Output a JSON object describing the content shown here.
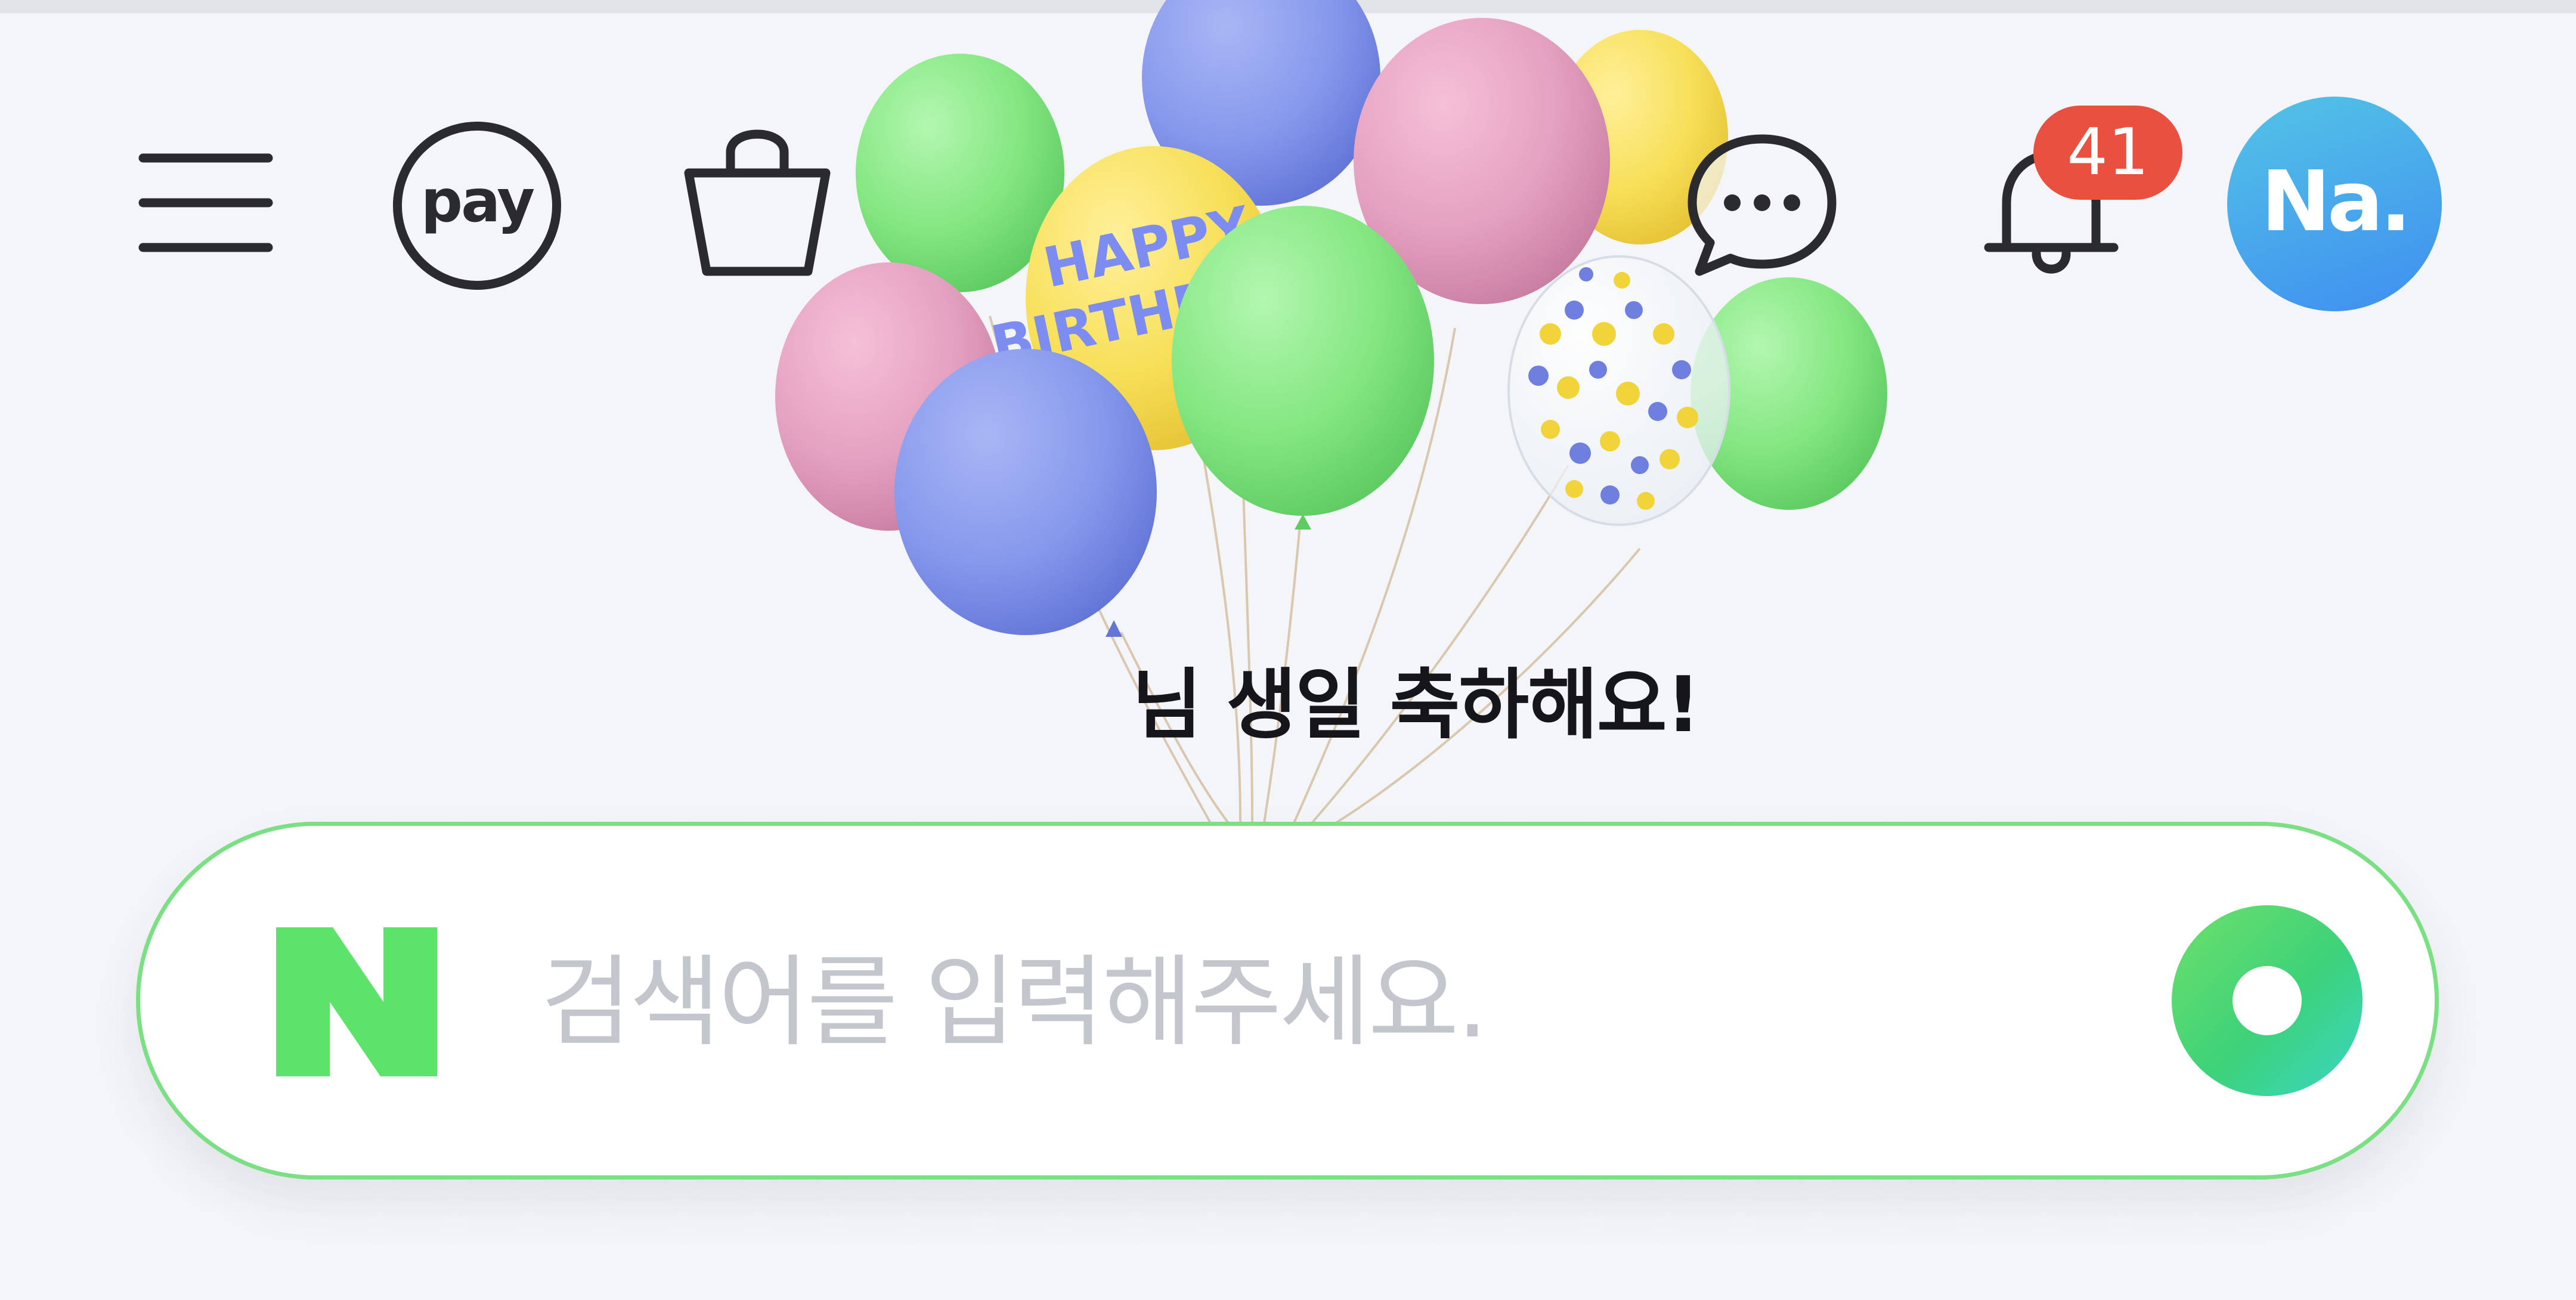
{
  "header": {
    "menu_icon": "hamburger-menu-icon",
    "pay_label": "pay",
    "shopping_icon": "shopping-bag-icon",
    "talk_icon": "chat-bubble-icon",
    "notification_icon": "bell-icon",
    "notification_count": "41",
    "avatar_text": "Na."
  },
  "hero": {
    "balloon_text": "HAPPY BIRTHDAY",
    "message": "님 생일 축하해요!"
  },
  "search": {
    "logo": "N",
    "placeholder": "검색어를 입력해주세요.",
    "value": "",
    "button_icon": "search-ring-icon"
  },
  "colors": {
    "search_border": "#7bdf84",
    "naver_green": "#5ce36a",
    "badge_red": "#e9503f",
    "avatar_blue": "#3f8ef0",
    "placeholder_gray": "#c4c6cd",
    "background": "#f4f5f8"
  }
}
